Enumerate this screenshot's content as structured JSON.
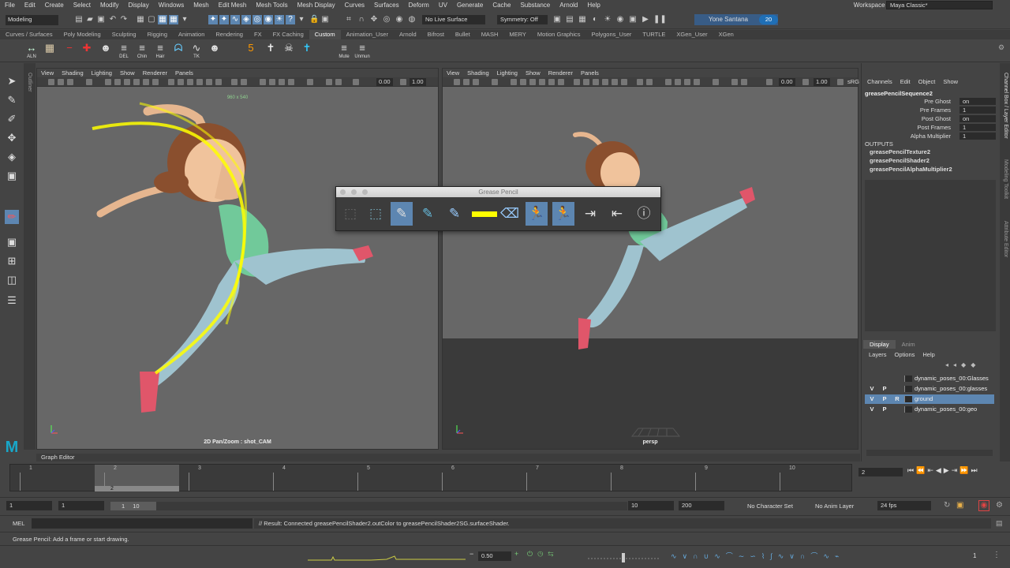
{
  "menu": {
    "items": [
      "File",
      "Edit",
      "Create",
      "Select",
      "Modify",
      "Display",
      "Windows",
      "Mesh",
      "Edit Mesh",
      "Mesh Tools",
      "Mesh Display",
      "Curves",
      "Surfaces",
      "Deform",
      "UV",
      "Generate",
      "Cache",
      "Substance",
      "Arnold",
      "Help"
    ],
    "workspace_label": "Workspace :",
    "workspace_value": "Maya Classic*"
  },
  "status": {
    "mode": "Modeling",
    "live_surface": "No Live Surface",
    "symmetry": "Symmetry: Off",
    "user": "Yone Santana",
    "badge": "20"
  },
  "shelf": {
    "tabs": [
      "Curves / Surfaces",
      "Poly Modeling",
      "Sculpting",
      "Rigging",
      "Animation",
      "Rendering",
      "FX",
      "FX Caching",
      "Custom",
      "Animation_User",
      "Arnold",
      "Bifrost",
      "Bullet",
      "MASH",
      "MERY",
      "Motion Graphics",
      "Polygons_User",
      "TURTLE",
      "XGen_User",
      "XGen"
    ],
    "active_tab": "Custom",
    "buttons": [
      {
        "icon": "↔",
        "label": "ALN"
      },
      {
        "icon": "▦",
        "label": ""
      },
      {
        "icon": "−",
        "label": ""
      },
      {
        "icon": "✚",
        "label": ""
      },
      {
        "icon": "☻",
        "label": ""
      },
      {
        "icon": "≡",
        "label": "DEL"
      },
      {
        "icon": "≡",
        "label": "Chin"
      },
      {
        "icon": "≡",
        "label": "Hair"
      },
      {
        "icon": "ᗣ",
        "label": ""
      },
      {
        "icon": "∿",
        "label": "TK"
      },
      {
        "icon": "☻",
        "label": ""
      },
      {
        "icon": "5",
        "label": ""
      },
      {
        "icon": "✝",
        "label": ""
      },
      {
        "icon": "☠",
        "label": ""
      },
      {
        "icon": "✝",
        "label": ""
      },
      {
        "icon": "≡",
        "label": "Mute"
      },
      {
        "icon": "≡",
        "label": "Unmun"
      }
    ]
  },
  "outliner_label": "Outliner",
  "viewport_left": {
    "menu": [
      "View",
      "Shading",
      "Lighting",
      "Show",
      "Renderer",
      "Panels"
    ],
    "num_a": "0.00",
    "num_b": "1.00",
    "resolution": "960 x 540",
    "label": "2D Pan/Zoom : shot_CAM"
  },
  "viewport_right": {
    "menu": [
      "View",
      "Shading",
      "Lighting",
      "Show",
      "Renderer",
      "Panels"
    ],
    "num_a": "0.00",
    "num_b": "1.00",
    "tail": "sRG",
    "label": "persp"
  },
  "grease_pencil": {
    "title": "Grease Pencil",
    "stroke_color": "#ffff00"
  },
  "channel_box": {
    "menu": [
      "Channels",
      "Edit",
      "Object",
      "Show"
    ],
    "node": "greasePencilSequence2",
    "attributes": [
      {
        "name": "Pre Ghost",
        "value": "on"
      },
      {
        "name": "Pre Frames",
        "value": "1"
      },
      {
        "name": "Post Ghost",
        "value": "on"
      },
      {
        "name": "Post Frames",
        "value": "1"
      },
      {
        "name": "Alpha Multiplier",
        "value": "1"
      }
    ],
    "outputs_label": "OUTPUTS",
    "outputs": [
      "greasePencilTexture2",
      "greasePencilShader2",
      "greasePencilAlphaMultiplier2"
    ]
  },
  "side_tabs": [
    "Channel Box / Layer Editor",
    "Modeling Toolkit",
    "Attribute Editor"
  ],
  "layer_editor": {
    "tabs": [
      "Display",
      "Anim"
    ],
    "menu": [
      "Layers",
      "Options",
      "Help"
    ],
    "layers": [
      {
        "v": "",
        "p": "",
        "r": "",
        "name": "dynamic_poses_00:Glasses",
        "selected": false
      },
      {
        "v": "V",
        "p": "P",
        "r": "",
        "name": "dynamic_poses_00:glasses",
        "selected": false
      },
      {
        "v": "V",
        "p": "P",
        "r": "R",
        "name": "ground",
        "selected": true
      },
      {
        "v": "V",
        "p": "P",
        "r": "",
        "name": "dynamic_poses_00:geo",
        "selected": false
      }
    ]
  },
  "graph_editor_label": "Graph Editor",
  "timeline": {
    "ticks": [
      "1",
      "2",
      "3",
      "4",
      "5",
      "6",
      "7",
      "8",
      "9",
      "10"
    ],
    "current_frame_marker": "2",
    "current_frame_field": "2"
  },
  "range": {
    "start": "1",
    "start_inner": "1",
    "slider_a": "1",
    "slider_b": "10",
    "end_inner": "10",
    "end": "200",
    "character_set": "No Character Set",
    "anim_layer": "No Anim Layer",
    "fps": "24 fps"
  },
  "command": {
    "lang": "MEL",
    "result": "// Result: Connected greasePencilShader2.outColor to greasePencilShader2SG.surfaceShader."
  },
  "help_line": "Grease Pencil: Add a frame or start drawing.",
  "bottom": {
    "value": "0.50",
    "frame": "1"
  }
}
